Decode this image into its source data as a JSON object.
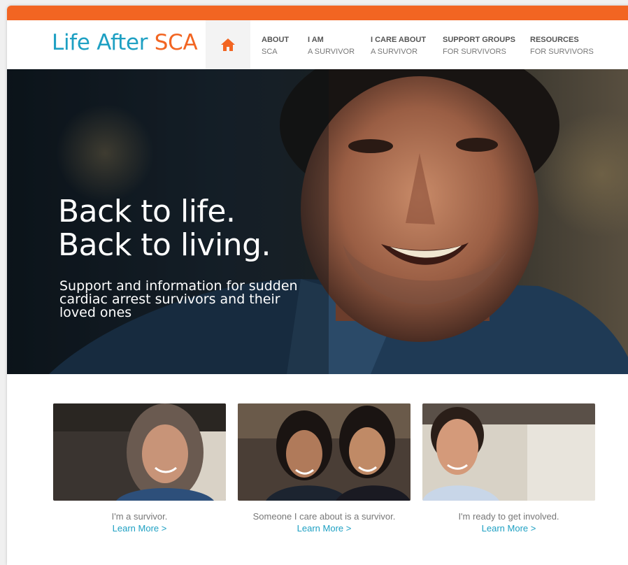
{
  "brand": {
    "name_part1": "Life After ",
    "name_part2": "SCA"
  },
  "colors": {
    "accent": "#f26522",
    "brand_blue": "#1ea0c3",
    "nav_text": "#555555"
  },
  "nav": {
    "home_icon": "home-icon",
    "items": [
      {
        "line1": "ABOUT",
        "line2": "SCA"
      },
      {
        "line1": "I AM",
        "line2": "A SURVIVOR"
      },
      {
        "line1": "I CARE ABOUT",
        "line2": "A SURVIVOR"
      },
      {
        "line1": "SUPPORT GROUPS",
        "line2": "FOR SURVIVORS"
      },
      {
        "line1": "RESOURCES",
        "line2": "FOR SURVIVORS"
      }
    ]
  },
  "hero": {
    "title_line1": "Back to life.",
    "title_line2": "Back to living.",
    "subtitle": "Support and information for sudden cardiac arrest survivors and their loved ones"
  },
  "cards": [
    {
      "caption": "I'm a survivor.",
      "link": "Learn More >"
    },
    {
      "caption": "Someone I care about is a survivor.",
      "link": "Learn More >"
    },
    {
      "caption": "I'm ready to get involved.",
      "link": "Learn More >"
    }
  ]
}
